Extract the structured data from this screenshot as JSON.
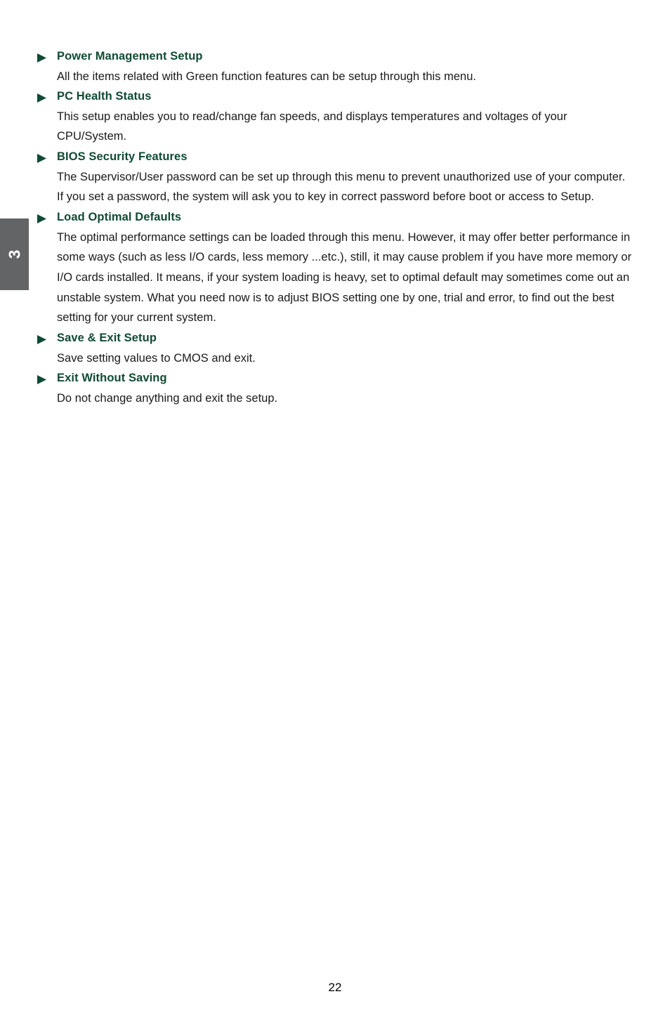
{
  "page": {
    "number": "22",
    "chapter_tab": {
      "label": "3",
      "background_color": "#636466",
      "text_color": "#ffffff"
    },
    "heading_color": "#104a33",
    "body_color": "#1a1a1a",
    "bullet_icon": "triangle-right-icon"
  },
  "sections": [
    {
      "title": "Power Management Setup",
      "body": "All the items related with Green function features can be setup through this menu."
    },
    {
      "title": "PC Health Status",
      "body": "This setup enables you to read/change fan speeds, and displays temperatures and voltages of your CPU/System."
    },
    {
      "title": "BIOS Security Features",
      "body": "The Supervisor/User password can be set up through this menu to prevent unauthorized use of your computer. If you set a password, the system will ask you to key in correct password before boot or access to Setup."
    },
    {
      "title": "Load Optimal Defaults",
      "body": "The optimal performance settings can be loaded through this menu. However, it may offer better performance in some ways (such as less I/O cards, less memory ...etc.), still, it may cause problem if you have more memory or I/O cards installed. It means, if your system loading is heavy, set to optimal default may sometimes come out an unstable system. What you need now is to adjust BIOS setting one by one, trial and error, to find out the best setting for your current system."
    },
    {
      "title": "Save & Exit Setup",
      "body": "Save setting values to CMOS and exit."
    },
    {
      "title": "Exit Without Saving",
      "body": "Do not change anything and exit the setup."
    }
  ]
}
